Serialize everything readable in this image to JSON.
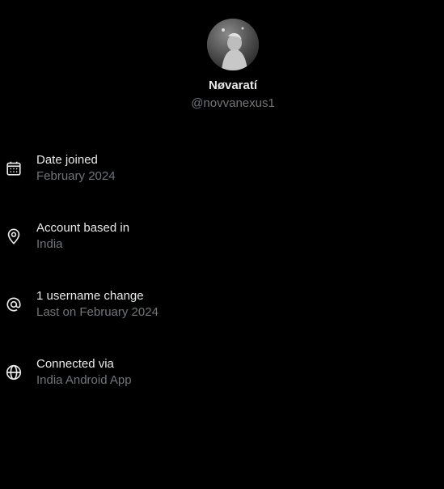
{
  "profile": {
    "display_name": "Nøvaratí",
    "handle": "@novvanexus1"
  },
  "info": [
    {
      "icon": "calendar-icon",
      "title": "Date joined",
      "subtitle": "February 2024"
    },
    {
      "icon": "location-pin-icon",
      "title": "Account based in",
      "subtitle": "India"
    },
    {
      "icon": "at-sign-icon",
      "title": "1 username change",
      "subtitle": "Last on February 2024"
    },
    {
      "icon": "globe-icon",
      "title": "Connected via",
      "subtitle": "India Android App"
    }
  ],
  "colors": {
    "background": "#000000",
    "primary_text": "#e7e9ea",
    "secondary_text": "#71767b"
  }
}
